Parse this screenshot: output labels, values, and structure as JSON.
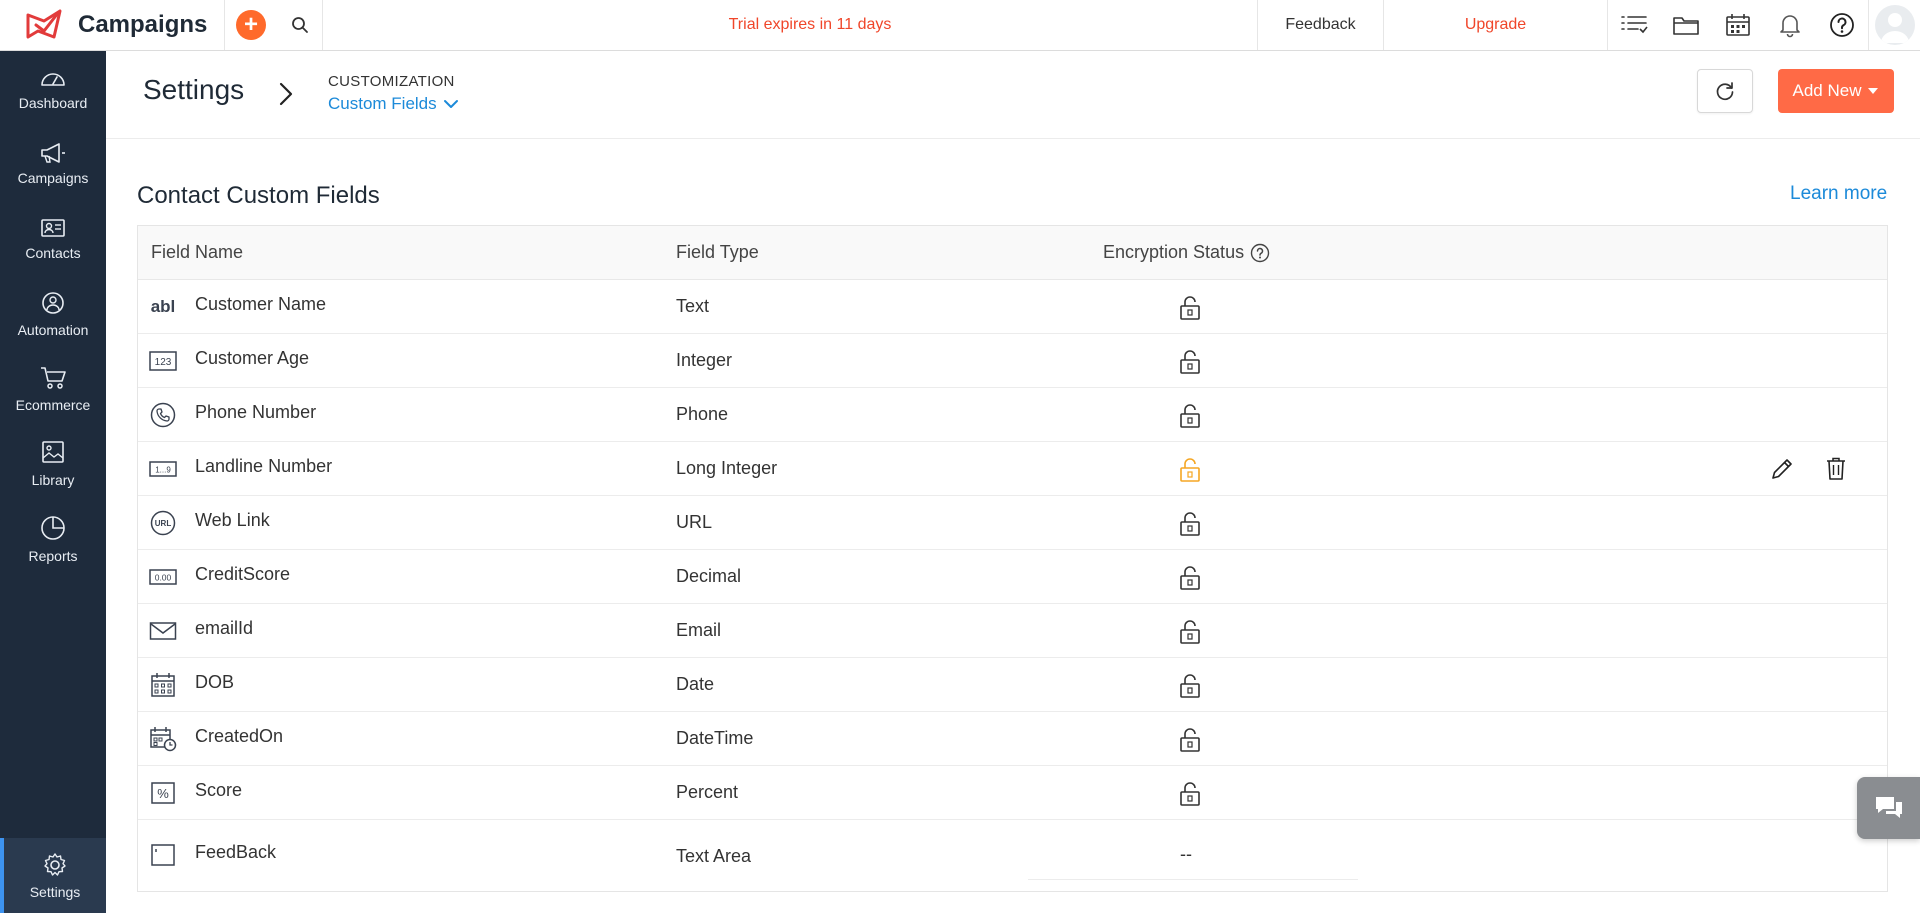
{
  "app": {
    "name": "Campaigns"
  },
  "topbar": {
    "trial_text": "Trial expires in 11 days",
    "feedback_label": "Feedback",
    "upgrade_label": "Upgrade",
    "icons": [
      "add-icon",
      "search-icon",
      "list-icon",
      "folder-icon",
      "calendar-icon",
      "bell-icon",
      "help-icon",
      "avatar"
    ]
  },
  "sidebar": {
    "items": [
      {
        "label": "Dashboard",
        "icon": "dashboard-icon"
      },
      {
        "label": "Campaigns",
        "icon": "megaphone-icon"
      },
      {
        "label": "Contacts",
        "icon": "contact-card-icon"
      },
      {
        "label": "Automation",
        "icon": "automation-icon"
      },
      {
        "label": "Ecommerce",
        "icon": "cart-icon"
      },
      {
        "label": "Library",
        "icon": "image-library-icon"
      },
      {
        "label": "Reports",
        "icon": "pie-chart-icon"
      }
    ],
    "settings_label": "Settings"
  },
  "header": {
    "title": "Settings",
    "breadcrumb_section": "CUSTOMIZATION",
    "breadcrumb_page": "Custom Fields",
    "add_new_label": "Add New"
  },
  "section": {
    "title": "Contact Custom Fields",
    "learn_more": "Learn more"
  },
  "table": {
    "columns": [
      "Field Name",
      "Field Type",
      "Encryption Status"
    ],
    "rows": [
      {
        "name": "Customer Name",
        "type": "Text",
        "icon": "text-abl-icon",
        "encryption": "unlocked"
      },
      {
        "name": "Customer Age",
        "type": "Integer",
        "icon": "integer-123-icon",
        "encryption": "unlocked"
      },
      {
        "name": "Phone Number",
        "type": "Phone",
        "icon": "phone-icon",
        "encryption": "unlocked"
      },
      {
        "name": "Landline Number",
        "type": "Long Integer",
        "icon": "long-integer-icon",
        "encryption": "unlocked-highlighted"
      },
      {
        "name": "Web Link",
        "type": "URL",
        "icon": "url-icon",
        "encryption": "unlocked"
      },
      {
        "name": "CreditScore",
        "type": "Decimal",
        "icon": "decimal-icon",
        "encryption": "unlocked"
      },
      {
        "name": "emailId",
        "type": "Email",
        "icon": "email-icon",
        "encryption": "unlocked"
      },
      {
        "name": "DOB",
        "type": "Date",
        "icon": "date-icon",
        "encryption": "unlocked"
      },
      {
        "name": "CreatedOn",
        "type": "DateTime",
        "icon": "datetime-icon",
        "encryption": "unlocked"
      },
      {
        "name": "Score",
        "type": "Percent",
        "icon": "percent-icon",
        "encryption": "unlocked"
      },
      {
        "name": "FeedBack",
        "type": "Text Area",
        "icon": "textarea-icon",
        "encryption": "--"
      }
    ]
  },
  "colors": {
    "sidebar_bg": "#1e2b3c",
    "accent_orange": "#ff6a46",
    "link_blue": "#1c8ad9",
    "trial_red": "#f0462a",
    "lock_highlight": "#f5a623"
  }
}
